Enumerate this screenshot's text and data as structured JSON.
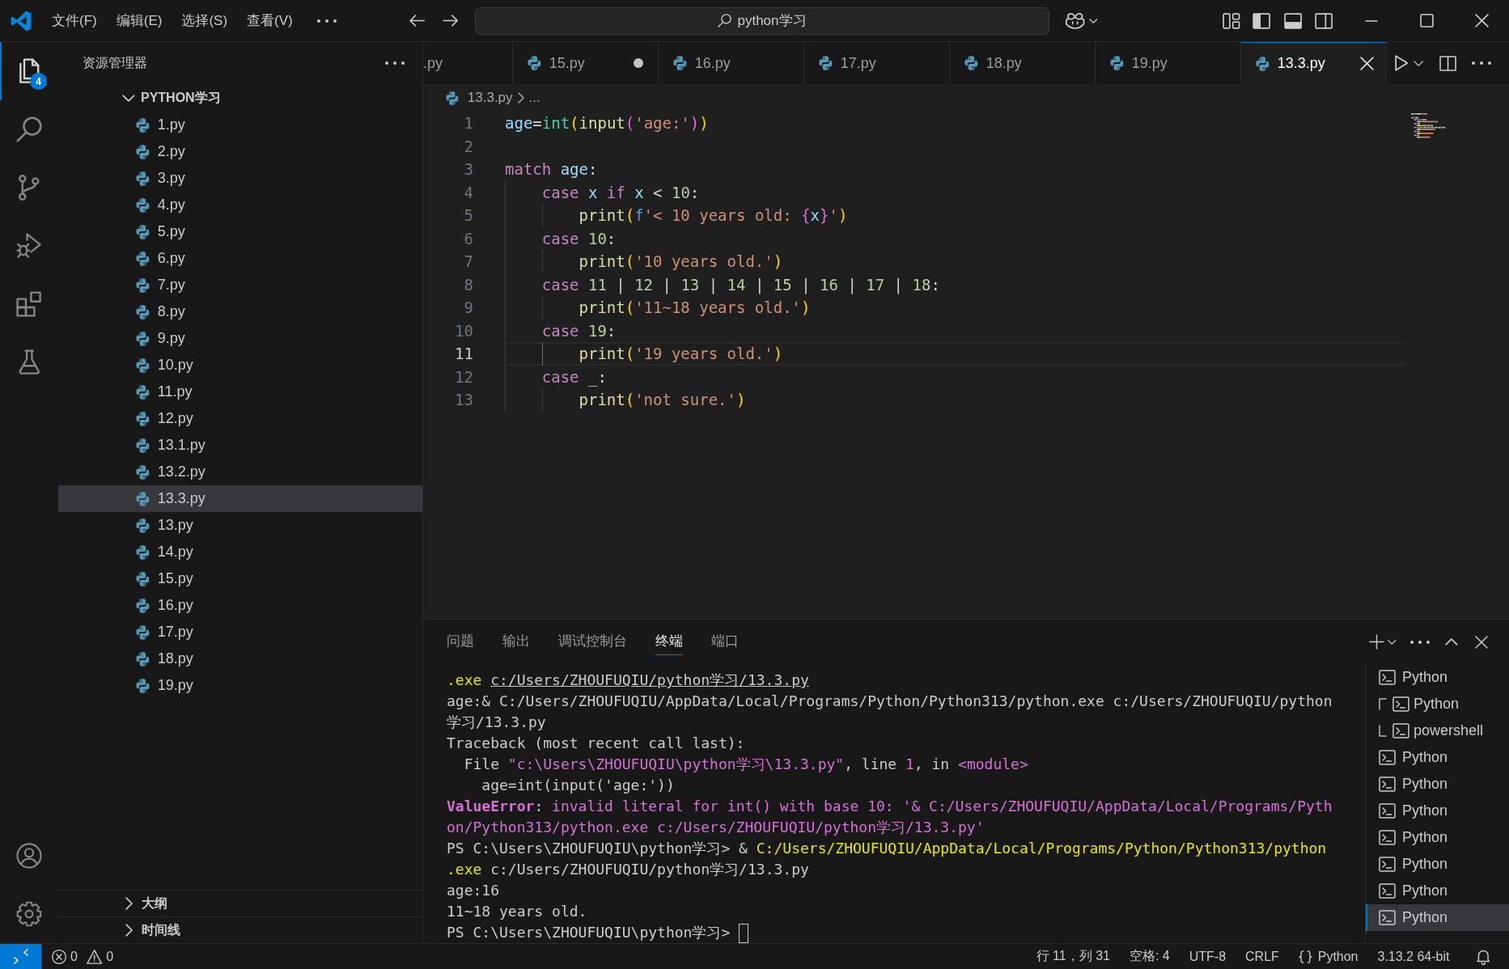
{
  "title_bar": {
    "menus": [
      "文件(F)",
      "编辑(E)",
      "选择(S)",
      "查看(V)"
    ],
    "command_center": "python学习"
  },
  "activity_bar": {
    "items": [
      {
        "kind": "explorer",
        "selected": true,
        "badge": "4"
      },
      {
        "kind": "search",
        "selected": false
      },
      {
        "kind": "source_control",
        "selected": false
      },
      {
        "kind": "run_debug",
        "selected": false
      },
      {
        "kind": "extensions",
        "selected": false
      },
      {
        "kind": "testing",
        "selected": false
      }
    ],
    "bottom_items": [
      {
        "kind": "accounts"
      },
      {
        "kind": "manage"
      }
    ]
  },
  "sidebar": {
    "title": "资源管理器",
    "folder": {
      "name": "PYTHON学习",
      "expanded": true,
      "files": [
        {
          "name": "1.py",
          "selected": false
        },
        {
          "name": "2.py",
          "selected": false
        },
        {
          "name": "3.py",
          "selected": false
        },
        {
          "name": "4.py",
          "selected": false
        },
        {
          "name": "5.py",
          "selected": false
        },
        {
          "name": "6.py",
          "selected": false
        },
        {
          "name": "7.py",
          "selected": false
        },
        {
          "name": "8.py",
          "selected": false
        },
        {
          "name": "9.py",
          "selected": false
        },
        {
          "name": "10.py",
          "selected": false
        },
        {
          "name": "11.py",
          "selected": false
        },
        {
          "name": "12.py",
          "selected": false
        },
        {
          "name": "13.1.py",
          "selected": false
        },
        {
          "name": "13.2.py",
          "selected": false
        },
        {
          "name": "13.3.py",
          "selected": true
        },
        {
          "name": "13.py",
          "selected": false
        },
        {
          "name": "14.py",
          "selected": false
        },
        {
          "name": "15.py",
          "selected": false
        },
        {
          "name": "16.py",
          "selected": false
        },
        {
          "name": "17.py",
          "selected": false
        },
        {
          "name": "18.py",
          "selected": false
        },
        {
          "name": "19.py",
          "selected": false
        }
      ]
    },
    "sections": [
      {
        "name": "大纲",
        "expanded": false
      },
      {
        "name": "时间线",
        "expanded": false
      }
    ]
  },
  "editor": {
    "tabs": [
      {
        "label": ".py",
        "clipped": true,
        "selected": false,
        "modified": false
      },
      {
        "label": "15.py",
        "clipped": false,
        "selected": false,
        "modified": true
      },
      {
        "label": "16.py",
        "clipped": false,
        "selected": false,
        "modified": false
      },
      {
        "label": "17.py",
        "clipped": false,
        "selected": false,
        "modified": false
      },
      {
        "label": "18.py",
        "clipped": false,
        "selected": false,
        "modified": false
      },
      {
        "label": "19.py",
        "clipped": false,
        "selected": false,
        "modified": false
      },
      {
        "label": "13.3.py",
        "clipped": false,
        "selected": true,
        "modified": false
      }
    ],
    "breadcrumb": [
      {
        "kind": "file",
        "label": "13.3.py"
      },
      {
        "kind": "symbol",
        "label": "..."
      }
    ],
    "lines": [
      {
        "number": "1",
        "current": false,
        "tokens": [
          {
            "kind": "variable",
            "text": "age"
          },
          {
            "kind": "operator",
            "text": "="
          },
          {
            "kind": "class",
            "text": "int"
          },
          {
            "kind": "bracket1",
            "text": "("
          },
          {
            "kind": "function",
            "text": "input"
          },
          {
            "kind": "bracket2",
            "text": "("
          },
          {
            "kind": "string",
            "text": "'age:'"
          },
          {
            "kind": "bracket2",
            "text": ")"
          },
          {
            "kind": "bracket1",
            "text": ")"
          }
        ]
      },
      {
        "number": "2",
        "current": false
      },
      {
        "number": "3",
        "current": false,
        "tokens": [
          {
            "kind": "keyword",
            "text": "match"
          },
          {
            "kind": "variable",
            "text": " age"
          },
          {
            "kind": "operator",
            "text": ":"
          }
        ],
        "children": [
          {
            "number": "4",
            "current": false,
            "tokens": [
              {
                "kind": "keyword",
                "text": "case"
              },
              {
                "kind": "variable",
                "text": " x"
              },
              {
                "kind": "keyword",
                "text": " if"
              },
              {
                "kind": "variable",
                "text": " x"
              },
              {
                "kind": "operator",
                "text": " < "
              },
              {
                "kind": "number",
                "text": "10"
              },
              {
                "kind": "operator",
                "text": ":"
              }
            ],
            "children": [
              {
                "number": "5",
                "current": false,
                "tokens": [
                  {
                    "kind": "function",
                    "text": "print"
                  },
                  {
                    "kind": "bracket1",
                    "text": "("
                  },
                  {
                    "kind": "storage",
                    "text": "f"
                  },
                  {
                    "kind": "string",
                    "text": "'< 10 years old: "
                  },
                  {
                    "kind": "bracket2",
                    "text": "{"
                  },
                  {
                    "kind": "variable",
                    "text": "x"
                  },
                  {
                    "kind": "bracket2",
                    "text": "}"
                  },
                  {
                    "kind": "string",
                    "text": "'"
                  },
                  {
                    "kind": "bracket1",
                    "text": ")"
                  }
                ]
              }
            ]
          },
          {
            "number": "6",
            "current": false,
            "tokens": [
              {
                "kind": "keyword",
                "text": "case"
              },
              {
                "kind": "number",
                "text": " 10"
              },
              {
                "kind": "operator",
                "text": ":"
              }
            ],
            "children": [
              {
                "number": "7",
                "current": false,
                "tokens": [
                  {
                    "kind": "function",
                    "text": "print"
                  },
                  {
                    "kind": "bracket1",
                    "text": "("
                  },
                  {
                    "kind": "string",
                    "text": "'10 years old.'"
                  },
                  {
                    "kind": "bracket1",
                    "text": ")"
                  }
                ]
              }
            ]
          },
          {
            "number": "8",
            "current": false,
            "tokens": [
              {
                "kind": "keyword",
                "text": "case"
              },
              {
                "kind": "number",
                "text": " 11"
              },
              {
                "kind": "operator",
                "text": " | "
              },
              {
                "kind": "number",
                "text": "12"
              },
              {
                "kind": "operator",
                "text": " | "
              },
              {
                "kind": "number",
                "text": "13"
              },
              {
                "kind": "operator",
                "text": " | "
              },
              {
                "kind": "number",
                "text": "14"
              },
              {
                "kind": "operator",
                "text": " | "
              },
              {
                "kind": "number",
                "text": "15"
              },
              {
                "kind": "operator",
                "text": " | "
              },
              {
                "kind": "number",
                "text": "16"
              },
              {
                "kind": "operator",
                "text": " | "
              },
              {
                "kind": "number",
                "text": "17"
              },
              {
                "kind": "operator",
                "text": " | "
              },
              {
                "kind": "number",
                "text": "18"
              },
              {
                "kind": "operator",
                "text": ":"
              }
            ],
            "children": [
              {
                "number": "9",
                "current": false,
                "tokens": [
                  {
                    "kind": "function",
                    "text": "print"
                  },
                  {
                    "kind": "bracket1",
                    "text": "("
                  },
                  {
                    "kind": "string",
                    "text": "'11~18 years old.'"
                  },
                  {
                    "kind": "bracket1",
                    "text": ")"
                  }
                ]
              }
            ]
          },
          {
            "number": "10",
            "current": false,
            "tokens": [
              {
                "kind": "keyword",
                "text": "case"
              },
              {
                "kind": "number",
                "text": " 19"
              },
              {
                "kind": "operator",
                "text": ":"
              }
            ],
            "children": [
              {
                "number": "11",
                "current": true,
                "tokens": [
                  {
                    "kind": "function",
                    "text": "print"
                  },
                  {
                    "kind": "bracket1",
                    "text": "("
                  },
                  {
                    "kind": "string",
                    "text": "'19 years old.'"
                  },
                  {
                    "kind": "bracket1",
                    "text": ")"
                  }
                ]
              }
            ]
          },
          {
            "number": "12",
            "current": false,
            "tokens": [
              {
                "kind": "keyword",
                "text": "case"
              },
              {
                "kind": "operator",
                "text": " _:"
              }
            ],
            "children": [
              {
                "number": "13",
                "current": false,
                "tokens": [
                  {
                    "kind": "function",
                    "text": "print"
                  },
                  {
                    "kind": "bracket1",
                    "text": "("
                  },
                  {
                    "kind": "string",
                    "text": "'not sure.'"
                  },
                  {
                    "kind": "bracket1",
                    "text": ")"
                  }
                ]
              }
            ]
          }
        ]
      }
    ]
  },
  "panel": {
    "tabs": [
      {
        "label": "问题",
        "selected": false
      },
      {
        "label": "输出",
        "selected": false
      },
      {
        "label": "调试控制台",
        "selected": false
      },
      {
        "label": "终端",
        "selected": true
      },
      {
        "label": "端口",
        "selected": false
      }
    ],
    "terminal": {
      "cursor": true,
      "lines": [
        {
          "segments": [
            {
              "kind": "command",
              "text": ".exe "
            },
            {
              "kind": "link",
              "text": "c:/Users/ZHOUFUQIU/python学习/13.3.py"
            }
          ]
        },
        {
          "segments": [
            {
              "kind": "plain",
              "text": "age:& C:/Users/ZHOUFUQIU/AppData/Local/Programs/Python/Python313/python.exe c:/Users/ZHOUFUQIU/python"
            }
          ]
        },
        {
          "segments": [
            {
              "kind": "plain",
              "text": "学习/13.3.py"
            }
          ]
        },
        {
          "segments": [
            {
              "kind": "plain",
              "text": "Traceback (most recent call last):"
            }
          ]
        },
        {
          "segments": [
            {
              "kind": "plain",
              "text": "  File "
            },
            {
              "kind": "error",
              "text": "\"c:\\Users\\ZHOUFUQIU\\python学习\\13.3.py\""
            },
            {
              "kind": "plain",
              "text": ", line "
            },
            {
              "kind": "error",
              "text": "1"
            },
            {
              "kind": "plain",
              "text": ", in "
            },
            {
              "kind": "error",
              "text": "<module>"
            }
          ]
        },
        {
          "segments": [
            {
              "kind": "plain",
              "text": "    age=int(input('age:'))"
            }
          ]
        },
        {
          "segments": [
            {
              "kind": "error_name",
              "text": "ValueError"
            },
            {
              "kind": "plain",
              "text": ": "
            },
            {
              "kind": "error",
              "text": "invalid literal for int() with base 10: '& C:/Users/ZHOUFUQIU/AppData/Local/Programs/Pyth"
            }
          ]
        },
        {
          "segments": [
            {
              "kind": "error",
              "text": "on/Python313/python.exe c:/Users/ZHOUFUQIU/python学习/13.3.py'"
            }
          ]
        },
        {
          "segments": [
            {
              "kind": "plain",
              "text": "PS C:\\Users\\ZHOUFUQIU\\python学习> & "
            },
            {
              "kind": "command",
              "text": "C:/Users/ZHOUFUQIU/AppData/Local/Programs/Python/Python313/python"
            }
          ]
        },
        {
          "segments": [
            {
              "kind": "command",
              "text": ".exe"
            },
            {
              "kind": "plain",
              "text": " c:/Users/ZHOUFUQIU/python学习/13.3.py"
            }
          ]
        },
        {
          "segments": [
            {
              "kind": "plain",
              "text": "age:16"
            }
          ]
        },
        {
          "segments": [
            {
              "kind": "plain",
              "text": "11~18 years old."
            }
          ]
        },
        {
          "segments": [
            {
              "kind": "plain",
              "text": "PS C:\\Users\\ZHOUFUQIU\\python学习> "
            }
          ]
        }
      ]
    },
    "terminals": [
      {
        "kind": "single",
        "label": "Python",
        "selected": false
      },
      {
        "kind": "split",
        "children": [
          {
            "label": "Python",
            "selected": false
          },
          {
            "label": "powershell",
            "selected": false
          }
        ]
      },
      {
        "kind": "single",
        "label": "Python",
        "selected": false
      },
      {
        "kind": "single",
        "label": "Python",
        "selected": false
      },
      {
        "kind": "single",
        "label": "Python",
        "selected": false
      },
      {
        "kind": "single",
        "label": "Python",
        "selected": false
      },
      {
        "kind": "single",
        "label": "Python",
        "selected": false
      },
      {
        "kind": "single",
        "label": "Python",
        "selected": false
      },
      {
        "kind": "single",
        "label": "Python",
        "selected": true
      }
    ]
  },
  "status_bar": {
    "problems": {
      "errors": "0",
      "warnings": "0"
    },
    "items": [
      {
        "kind": "text",
        "label": "行 11，列 31"
      },
      {
        "kind": "text",
        "label": "空格: 4"
      },
      {
        "kind": "text",
        "label": "UTF-8"
      },
      {
        "kind": "text",
        "label": "CRLF"
      },
      {
        "kind": "language",
        "label": "Python"
      },
      {
        "kind": "text",
        "label": "3.13.2 64-bit"
      }
    ]
  }
}
